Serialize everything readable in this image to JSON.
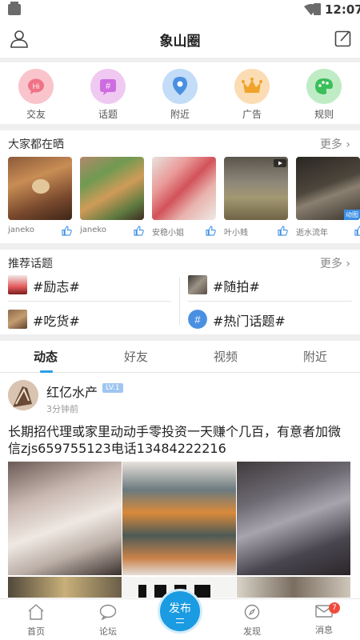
{
  "status_bar": {
    "time": "12:07"
  },
  "header": {
    "title": "象山圈"
  },
  "categories": [
    {
      "label": "交友",
      "icon": "hi-bubble-icon",
      "bg": "#f9c4cb"
    },
    {
      "label": "话题",
      "icon": "hash-icon",
      "bg": "#efc9f1"
    },
    {
      "label": "附近",
      "icon": "location-pin-icon",
      "bg": "#c3dcf7"
    },
    {
      "label": "广告",
      "icon": "crown-icon",
      "bg": "#fbdcb3"
    },
    {
      "label": "规则",
      "icon": "palette-icon",
      "bg": "#bfecc5"
    }
  ],
  "shares": {
    "title": "大家都在晒",
    "more": "更多",
    "items": [
      {
        "user": "janeko"
      },
      {
        "user": "janeko"
      },
      {
        "user": "安稳小姐"
      },
      {
        "user": "叶小贱"
      },
      {
        "user": "逝水流年",
        "badge": "动图"
      }
    ]
  },
  "topics": {
    "title": "推荐话题",
    "more": "更多",
    "items": [
      {
        "label": "#励志#"
      },
      {
        "label": "#随拍#"
      },
      {
        "label": "#吃货#"
      },
      {
        "label": "#热门话题#"
      }
    ]
  },
  "tabs": [
    "动态",
    "好友",
    "视频",
    "附近"
  ],
  "post": {
    "author": "红亿水产",
    "level": "LV.1",
    "time": "3分钟前",
    "text": "长期招代理或家里动动手零投资一天赚个几百，有意者加微信zjs659755123电话13484222216"
  },
  "bottom_nav": {
    "items": [
      {
        "label": "首页",
        "icon": "home-icon"
      },
      {
        "label": "论坛",
        "icon": "chat-bubble-icon"
      },
      {
        "label": "发现",
        "icon": "compass-icon"
      },
      {
        "label": "消息",
        "icon": "mail-icon",
        "badge": "7"
      }
    ],
    "publish": "发布"
  },
  "colors": {
    "accent": "#2aa0e4",
    "publish": "#1a9be2",
    "badge": "#f04a3a"
  }
}
